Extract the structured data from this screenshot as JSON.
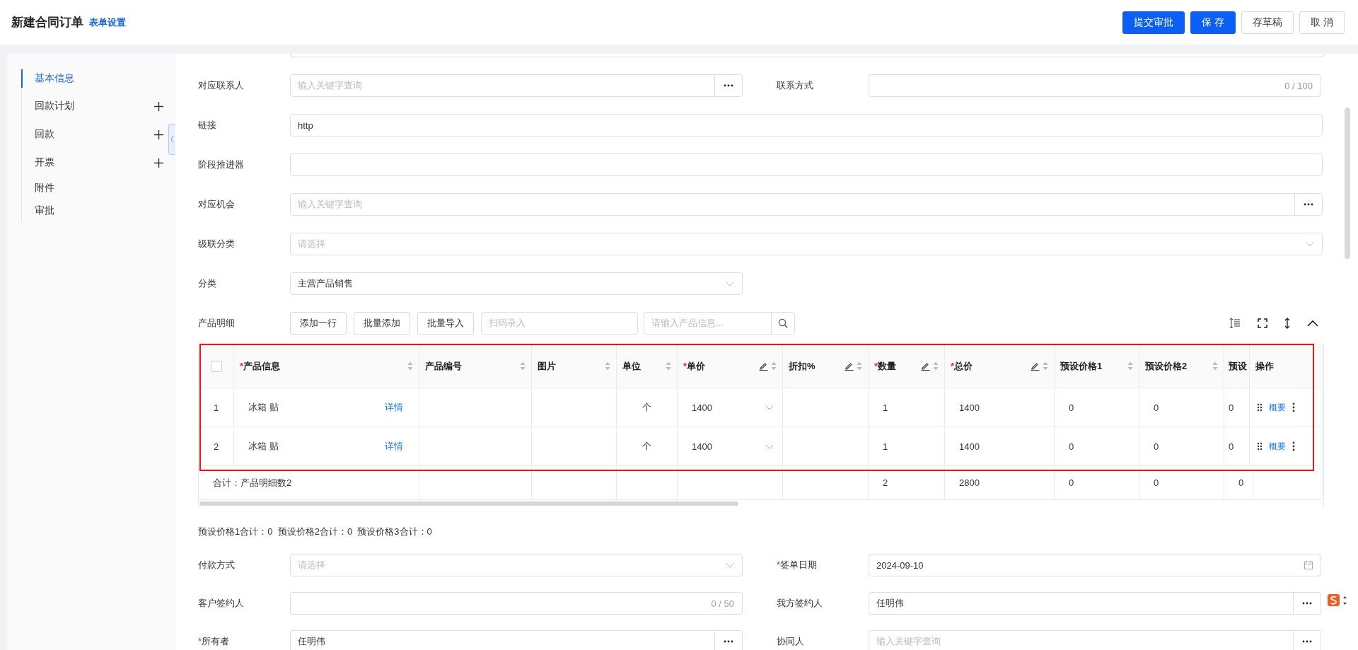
{
  "header": {
    "title": "新建合同订单",
    "link": "表单设置",
    "buttons": [
      {
        "label": "提交审批",
        "kind": "primary"
      },
      {
        "label": "保 存",
        "kind": "primary"
      },
      {
        "label": "存草稿",
        "kind": "default"
      },
      {
        "label": "取 消",
        "kind": "default"
      }
    ]
  },
  "sidebar": {
    "items": [
      {
        "label": "基本信息",
        "selected": true,
        "addable": false
      },
      {
        "label": "回款计划",
        "selected": false,
        "addable": true
      },
      {
        "label": "回款",
        "selected": false,
        "addable": true
      },
      {
        "label": "开票",
        "selected": false,
        "addable": true
      },
      {
        "label": "附件",
        "selected": false,
        "addable": false
      },
      {
        "label": "审批",
        "selected": false,
        "addable": false
      }
    ]
  },
  "form_top": [
    {
      "fields": [
        {
          "label": "对应联系人",
          "kind": "lookup",
          "placeholder": "输入关键字查询"
        },
        {
          "label": "联系方式",
          "kind": "text",
          "counter": "0 / 100"
        }
      ]
    },
    {
      "fields": [
        {
          "label": "链接",
          "kind": "text",
          "value": "http"
        }
      ]
    },
    {
      "fields": [
        {
          "label": "阶段推进器",
          "kind": "text"
        }
      ]
    },
    {
      "fields": [
        {
          "label": "对应机会",
          "kind": "lookup",
          "placeholder": "输入关键字查询"
        }
      ]
    },
    {
      "fields": [
        {
          "label": "级联分类",
          "kind": "select",
          "placeholder": "请选择"
        }
      ]
    },
    {
      "fields": [
        {
          "label": "分类",
          "kind": "select",
          "value": "主营产品销售"
        }
      ]
    }
  ],
  "product_section": {
    "label": "产品明细",
    "buttons": [
      "添加一行",
      "批量添加",
      "批量导入"
    ],
    "scan_field": {
      "placeholder": "扫码录入"
    },
    "search_field": {
      "placeholder": "请输入产品信息..."
    },
    "table": {
      "columns": [
        {
          "kind": "checkbox",
          "checked": false
        },
        {
          "kind": "label",
          "label": "产品信息",
          "mark": "*",
          "sortable": true,
          "editable": false
        },
        {
          "kind": "label",
          "label": "产品编号",
          "sortable": true,
          "editable": false
        },
        {
          "kind": "label",
          "label": "图片",
          "sortable": true,
          "editable": false
        },
        {
          "kind": "label",
          "label": "单位",
          "sortable": true,
          "editable": false
        },
        {
          "kind": "label",
          "label": "单价",
          "mark": "*",
          "sortable": true,
          "editable": true
        },
        {
          "kind": "label",
          "label": "折扣%",
          "sortable": true,
          "editable": true
        },
        {
          "kind": "label",
          "label": "数量",
          "mark": "*",
          "sortable": true,
          "editable": true
        },
        {
          "kind": "label",
          "label": "总价",
          "mark": "*",
          "sortable": true,
          "editable": true
        },
        {
          "kind": "label",
          "label": "预设价格1",
          "sortable": true,
          "editable": false
        },
        {
          "kind": "label",
          "label": "预设价格2",
          "sortable": true,
          "editable": false
        },
        {
          "kind": "label",
          "label": "预设",
          "sortable": false,
          "editable": false
        },
        {
          "kind": "label",
          "label": "操作",
          "sortable": false,
          "editable": false
        }
      ],
      "rows": [
        {
          "cells": [
            {
              "kind": "index",
              "text": "1"
            },
            {
              "kind": "product",
              "text": "冰箱 贴",
              "link": "详情"
            },
            {
              "kind": "text"
            },
            {
              "kind": "text"
            },
            {
              "kind": "center",
              "text": "个"
            },
            {
              "kind": "select",
              "text": "1400"
            },
            {
              "kind": "text"
            },
            {
              "kind": "text",
              "text": "1"
            },
            {
              "kind": "text",
              "text": "1400"
            },
            {
              "kind": "text",
              "text": "0"
            },
            {
              "kind": "text",
              "text": "0"
            },
            {
              "kind": "text",
              "text": "0"
            },
            {
              "kind": "actions",
              "link": "概要"
            }
          ]
        },
        {
          "cells": [
            {
              "kind": "index",
              "text": "2"
            },
            {
              "kind": "product",
              "text": "冰箱 贴",
              "link": "详情"
            },
            {
              "kind": "text"
            },
            {
              "kind": "text"
            },
            {
              "kind": "center",
              "text": "个"
            },
            {
              "kind": "select",
              "text": "1400"
            },
            {
              "kind": "text"
            },
            {
              "kind": "text",
              "text": "1"
            },
            {
              "kind": "text",
              "text": "1400"
            },
            {
              "kind": "text",
              "text": "0"
            },
            {
              "kind": "text",
              "text": "0"
            },
            {
              "kind": "text",
              "text": "0"
            },
            {
              "kind": "actions",
              "link": "概要"
            }
          ]
        }
      ],
      "total_row": {
        "cells": [
          {
            "kind": "summary",
            "text": "合计：产品明细数2"
          },
          {
            "kind": "text"
          },
          {
            "kind": "text"
          },
          {
            "kind": "text"
          },
          {
            "kind": "text"
          },
          {
            "kind": "text"
          },
          {
            "kind": "text",
            "text": "2"
          },
          {
            "kind": "text",
            "text": "2800"
          },
          {
            "kind": "text",
            "text": "0"
          },
          {
            "kind": "text",
            "text": "0"
          },
          {
            "kind": "text",
            "text": "0"
          },
          {
            "kind": "text"
          }
        ]
      }
    },
    "sums": "预设价格1合计：0  预设价格2合计：0  预设价格3合计：0"
  },
  "form_bottom": [
    {
      "fields": [
        {
          "label": "付款方式",
          "kind": "select",
          "placeholder": "请选择"
        },
        {
          "label": "签单日期",
          "mark": "*",
          "kind": "date",
          "value": "2024-09-10"
        }
      ]
    },
    {
      "fields": [
        {
          "label": "客户签约人",
          "kind": "text",
          "counter": "0 / 50"
        },
        {
          "label": "我方签约人",
          "kind": "lookup",
          "value": "任明伟"
        }
      ]
    },
    {
      "fields": [
        {
          "label": "所有者",
          "mark": "*",
          "kind": "lookup",
          "value": "任明伟"
        },
        {
          "label": "协同人",
          "kind": "lookup",
          "placeholder": "输入关键字查询"
        }
      ]
    }
  ]
}
